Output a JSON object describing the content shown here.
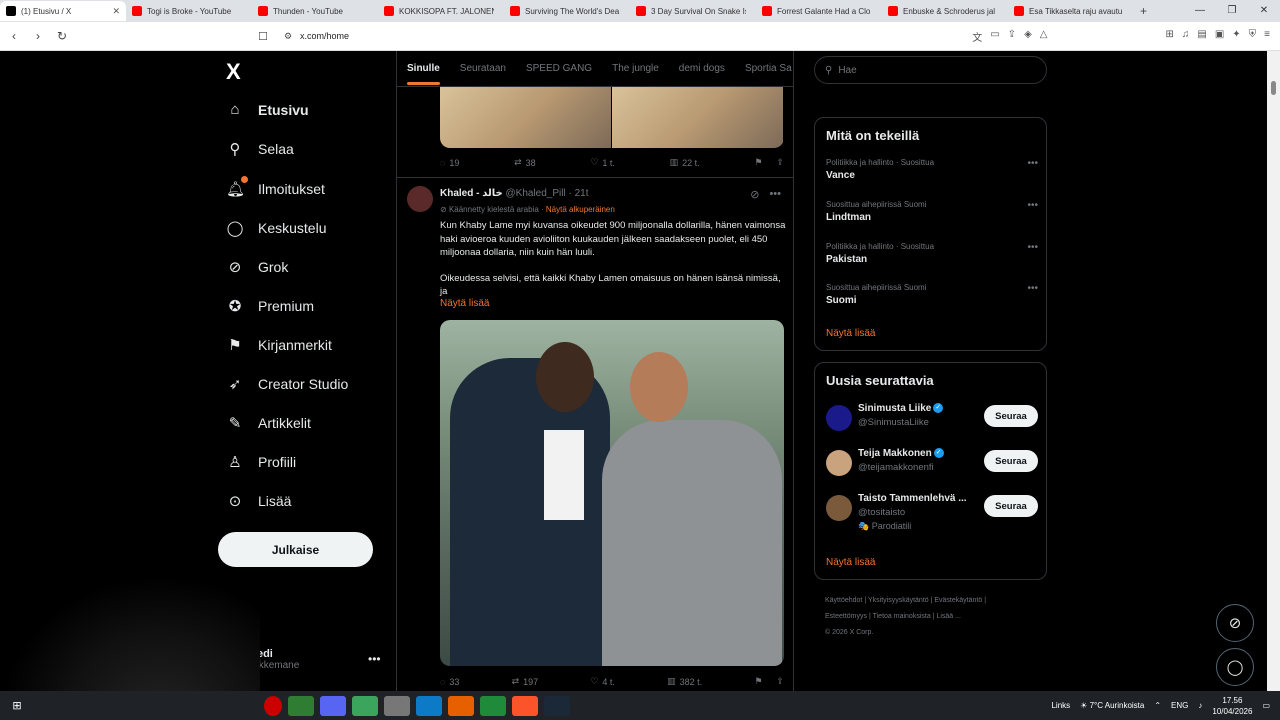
{
  "browser": {
    "tabs": [
      {
        "title": "(1) Etusivu / X",
        "active": true,
        "icon": "x-favicon"
      },
      {
        "title": "Togi is Broke - YouTube",
        "icon": "youtube-favicon"
      },
      {
        "title": "Thunden - YouTube",
        "icon": "youtube-favicon"
      },
      {
        "title": "KOKKISOPA FT. JALONEN",
        "icon": "youtube-favicon"
      },
      {
        "title": "Surviving The World's Dea",
        "icon": "youtube-favicon"
      },
      {
        "title": "3 Day Survival On Snake Is",
        "icon": "youtube-favicon"
      },
      {
        "title": "Forrest Galante Had a Clo",
        "icon": "youtube-favicon"
      },
      {
        "title": "Enbuske & Schroderus jal",
        "icon": "youtube-favicon"
      },
      {
        "title": "Esa Tikkaselta raju avautu",
        "icon": "youtube-favicon"
      }
    ],
    "url": "x.com/home"
  },
  "sidebar": {
    "logo": "X",
    "items": [
      {
        "label": "Etusivu",
        "icon": "home-icon",
        "bold": true
      },
      {
        "label": "Selaa",
        "icon": "search-icon"
      },
      {
        "label": "Ilmoitukset",
        "icon": "bell-icon",
        "badge": true
      },
      {
        "label": "Keskustelu",
        "icon": "chat-icon"
      },
      {
        "label": "Grok",
        "icon": "grok-icon"
      },
      {
        "label": "Premium",
        "icon": "premium-icon"
      },
      {
        "label": "Kirjanmerkit",
        "icon": "bookmark-icon"
      },
      {
        "label": "Creator Studio",
        "icon": "rocket-icon"
      },
      {
        "label": "Artikkelit",
        "icon": "article-icon"
      },
      {
        "label": "Profiili",
        "icon": "person-icon"
      },
      {
        "label": "Lisää",
        "icon": "more-circle-icon"
      }
    ],
    "post_label": "Julkaise",
    "account": {
      "name": "mikedi",
      "handle": "@mikkemane"
    }
  },
  "feed": {
    "tabs": [
      "Sinulle",
      "Seurataan",
      "SPEED GANG",
      "The jungle",
      "demi dogs",
      "Sportia Sa"
    ],
    "prev_actions": {
      "replies": "19",
      "reposts": "38",
      "likes": "1 t.",
      "views": "22 t."
    },
    "tweet": {
      "author": "Khaled - خالد",
      "handle": "@Khaled_Pill",
      "time": "21t",
      "translated_note": "Käännetty kielestä arabia",
      "show_original": "Näytä alkuperäinen",
      "text_1": "Kun Khaby Lame myi kuvansa oikeudet 900 miljoonalla dollarilla, hänen vaimonsa haki avioeroa kuuden avioliiton kuukauden jälkeen saadakseen puolet, eli 450 miljoonaa dollaria, niin kuin hän luuli.",
      "text_2": "Oikeudessa selvisi, että kaikki Khaby Lamen omaisuus on hänen isänsä nimissä, ja",
      "show_more": "Näytä lisää",
      "actions": {
        "replies": "33",
        "reposts": "197",
        "likes": "4 t.",
        "views": "382 t."
      }
    }
  },
  "right": {
    "search_placeholder": "Hae",
    "trends_title": "Mitä on tekeillä",
    "trends": [
      {
        "meta": "Politiikka ja hallinto · Suosittua",
        "name": "Vance"
      },
      {
        "meta": "Suosittua aihepiirissä Suomi",
        "name": "Lindtman"
      },
      {
        "meta": "Politiikka ja hallinto · Suosittua",
        "name": "Pakistan"
      },
      {
        "meta": "Suosittua aihepiirissä Suomi",
        "name": "Suomi"
      }
    ],
    "show_more": "Näytä lisää",
    "who_title": "Uusia seurattavia",
    "who": [
      {
        "name": "Sinimusta Liike",
        "handle": "@SinimustaLiike",
        "extra": "",
        "color": "#1a1a8a"
      },
      {
        "name": "Teija Makkonen",
        "handle": "@teijamakkonenfi",
        "extra": "",
        "color": "#c9a27e"
      },
      {
        "name": "Taisto Tammenlehvä ...",
        "handle": "@tositaisto",
        "extra": "🎭 Parodiatili",
        "color": "#7a5a3a"
      }
    ],
    "follow_label": "Seuraa",
    "who_more": "Näytä lisää",
    "footer": [
      "Käyttöehdot",
      "Yksityisyyskäytäntö",
      "Evästekäytäntö",
      "Esteettömyys",
      "Tietoa mainoksista",
      "Lisää ...",
      "© 2026 X Corp."
    ]
  },
  "taskbar": {
    "links": "Links",
    "weather": "7°C Aurinkoista",
    "lang": "ENG",
    "time": "17.56",
    "date": "10/04/2026"
  }
}
